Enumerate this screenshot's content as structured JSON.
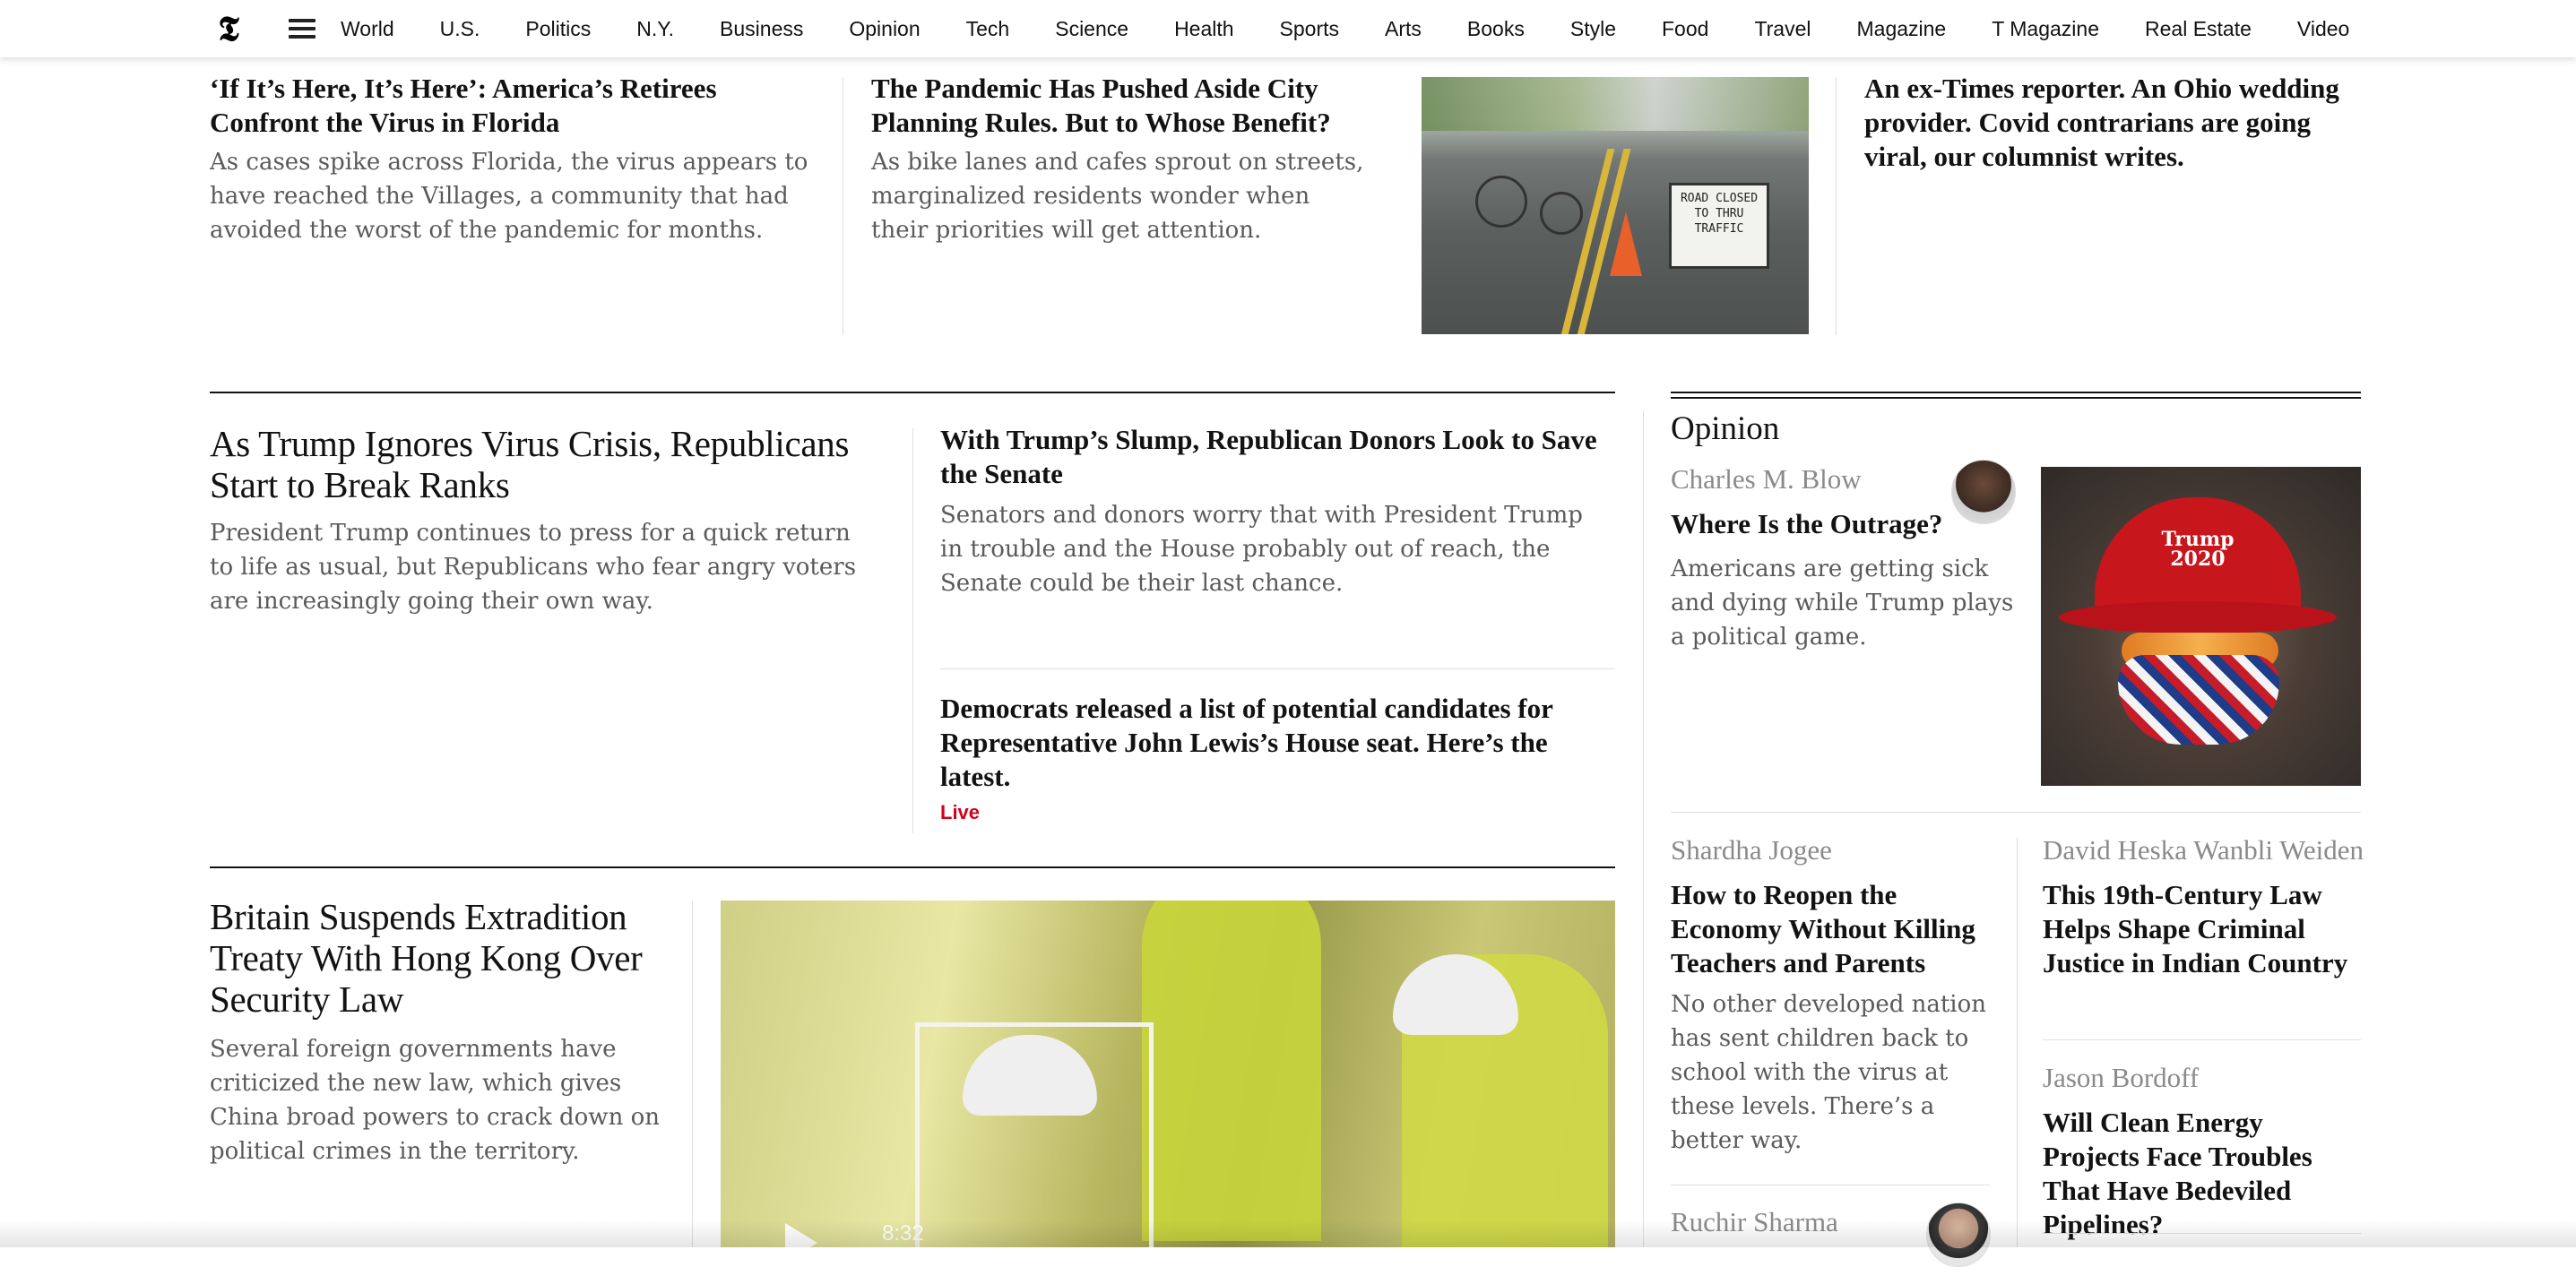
{
  "nav": {
    "logo": "𝕿",
    "links": [
      "World",
      "U.S.",
      "Politics",
      "N.Y.",
      "Business",
      "Opinion",
      "Tech",
      "Science",
      "Health",
      "Sports",
      "Arts",
      "Books",
      "Style",
      "Food",
      "Travel",
      "Magazine",
      "T Magazine",
      "Real Estate",
      "Video"
    ]
  },
  "top_row": {
    "story1": {
      "headline": "‘If It’s Here, It’s Here’: America’s Retirees Confront the Virus in Florida",
      "summary": "As cases spike across Florida, the virus appears to have reached the Villages, a community that had avoided the worst of the pandemic for months."
    },
    "story2": {
      "headline": "The Pandemic Has Pushed Aside City Planning Rules. But to Whose Benefit?",
      "summary": "As bike lanes and cafes sprout on streets, marginalized residents wonder when their priorities will get attention.",
      "image_sign": "ROAD CLOSED TO THRU TRAFFIC"
    },
    "story3": {
      "headline": "An ex-Times reporter. An Ohio wedding provider. Covid contrarians are going viral, our columnist writes."
    }
  },
  "middle": {
    "lead": {
      "headline": "As Trump Ignores Virus Crisis, Republicans Start to Break Ranks",
      "summary": "President Trump continues to press for a quick return to life as usual, but Republicans who fear angry voters are increasingly going their own way."
    },
    "side1": {
      "headline": "With Trump’s Slump, Republican Donors Look to Save the Senate",
      "summary": "Senators and donors worry that with President Trump in trouble and the House probably out of reach, the Senate could be their last chance."
    },
    "side2": {
      "headline": "Democrats released a list of potential candidates for Representative John Lewis’s House seat. Here’s the latest.",
      "badge": "Live"
    }
  },
  "britain": {
    "headline": "Britain Suspends Extradition Treaty With Hong Kong Over Security Law",
    "summary": "Several foreign governments have criticized the new law, which gives China broad powers to crack down on political crimes in the territory.",
    "video_duration": "8:32"
  },
  "opinion": {
    "section_title": "Opinion",
    "featured": {
      "author": "Charles M. Blow",
      "headline": "Where Is the Outrage?",
      "summary": "Americans are getting sick and dying while Trump plays a political game.",
      "image_hat_text": "Trump 2020"
    },
    "col_left": [
      {
        "author": "Shardha Jogee",
        "headline": "How to Reopen the Economy Without Killing Teachers and Parents",
        "summary": "No other developed nation has sent children back to school with the virus at these levels. There’s a better way."
      },
      {
        "author": "Ruchir Sharma"
      }
    ],
    "col_right": [
      {
        "author": "David Heska Wanbli Weiden",
        "headline": "This 19th-Century Law Helps Shape Criminal Justice in Indian Country"
      },
      {
        "author": "Jason Bordoff",
        "headline": "Will Clean Energy Projects Face Troubles That Have Bedeviled Pipelines?"
      }
    ]
  }
}
